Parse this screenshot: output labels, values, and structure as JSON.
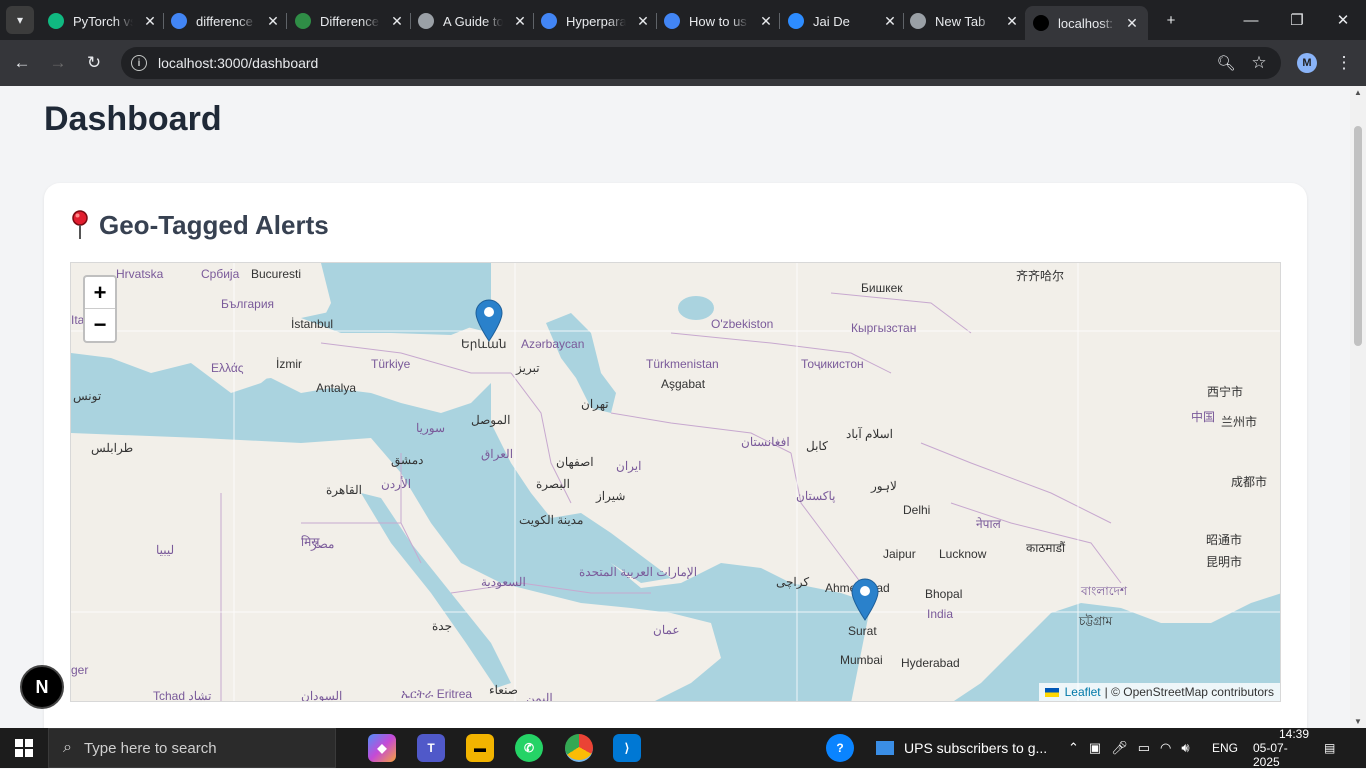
{
  "browser": {
    "tabs": [
      {
        "title": "PyTorch vs",
        "favicon": "pytorch-icon",
        "color": "#10b981"
      },
      {
        "title": "difference",
        "favicon": "google-icon",
        "color": "#4285f4"
      },
      {
        "title": "Difference",
        "favicon": "gfg-icon",
        "color": "#2f8d46"
      },
      {
        "title": "A Guide to",
        "favicon": "guide-icon",
        "color": "#9aa0a6"
      },
      {
        "title": "Hyperparam",
        "favicon": "google-icon",
        "color": "#4285f4"
      },
      {
        "title": "How to us",
        "favicon": "google-icon",
        "color": "#4285f4"
      },
      {
        "title": "Jai De",
        "favicon": "zoom-icon",
        "color": "#2d8cff"
      },
      {
        "title": "New Tab",
        "favicon": "chrome-icon",
        "color": "#9aa0a6"
      },
      {
        "title": "localhost:",
        "favicon": "vercel-icon",
        "color": "#000000"
      }
    ],
    "url": "localhost:3000/dashboard",
    "profile_initial": "M"
  },
  "page": {
    "title": "Dashboard",
    "card_title": "Geo-Tagged Alerts",
    "card_icon": "pin-icon"
  },
  "map": {
    "zoom_in": "+",
    "zoom_out": "−",
    "attribution_leaflet": "Leaflet",
    "attribution_osm": "| © OpenStreetMap contributors",
    "labels": [
      {
        "text": "Hrvatska",
        "type": "country"
      },
      {
        "text": "Србија",
        "type": "country"
      },
      {
        "text": "Bucuresti",
        "type": "city"
      },
      {
        "text": "България",
        "type": "country"
      },
      {
        "text": "İstanbul",
        "type": "city"
      },
      {
        "text": "Italia",
        "type": "country"
      },
      {
        "text": "İzmir",
        "type": "city"
      },
      {
        "text": "Türkiye",
        "type": "country"
      },
      {
        "text": "Ελλάς",
        "type": "country"
      },
      {
        "text": "Antalya",
        "type": "city"
      },
      {
        "text": "Երևան",
        "type": "city"
      },
      {
        "text": "Azərbaycan",
        "type": "country"
      },
      {
        "text": "O'zbekiston",
        "type": "country"
      },
      {
        "text": "Бишкек",
        "type": "city"
      },
      {
        "text": "Кыргызстан",
        "type": "country"
      },
      {
        "text": "Türkmenistan",
        "type": "country"
      },
      {
        "text": "Aşgabat",
        "type": "city"
      },
      {
        "text": "Тоҷикистон",
        "type": "country"
      },
      {
        "text": "تبریز",
        "type": "city"
      },
      {
        "text": "تهران",
        "type": "city"
      },
      {
        "text": "سوريا",
        "type": "country"
      },
      {
        "text": "الموصل",
        "type": "city"
      },
      {
        "text": "العراق",
        "type": "country"
      },
      {
        "text": "دمشق",
        "type": "city"
      },
      {
        "text": "الأردن",
        "type": "country"
      },
      {
        "text": "اصفهان",
        "type": "city"
      },
      {
        "text": "ایران",
        "type": "country"
      },
      {
        "text": "افغانستان",
        "type": "country"
      },
      {
        "text": "کابل",
        "type": "city"
      },
      {
        "text": "اسلام آباد",
        "type": "city"
      },
      {
        "text": "البصرة",
        "type": "city"
      },
      {
        "text": "شیراز",
        "type": "city"
      },
      {
        "text": "پاکستان",
        "type": "country"
      },
      {
        "text": "لاہور",
        "type": "city"
      },
      {
        "text": "القاهرة",
        "type": "city"
      },
      {
        "text": "مدينة الكويت",
        "type": "city"
      },
      {
        "text": "Delhi",
        "type": "city"
      },
      {
        "text": "मिस्र",
        "type": "country"
      },
      {
        "text": "مصر",
        "type": "country"
      },
      {
        "text": "Jaipur",
        "type": "city"
      },
      {
        "text": "Lucknow",
        "type": "city"
      },
      {
        "text": "नेपाल",
        "type": "country"
      },
      {
        "text": "काठमाडौं",
        "type": "city"
      },
      {
        "text": "ليبيا",
        "type": "country"
      },
      {
        "text": "الإمارات العربية المتحدة",
        "type": "country"
      },
      {
        "text": "كراچى",
        "type": "city"
      },
      {
        "text": "Ahmedabad",
        "type": "city"
      },
      {
        "text": "Bhopal",
        "type": "city"
      },
      {
        "text": "India",
        "type": "country"
      },
      {
        "text": "বাংলাদেশ",
        "type": "country"
      },
      {
        "text": "السعودية",
        "type": "country"
      },
      {
        "text": "Surat",
        "type": "city"
      },
      {
        "text": "جدة",
        "type": "city"
      },
      {
        "text": "عمان",
        "type": "country"
      },
      {
        "text": "Mumbai",
        "type": "city"
      },
      {
        "text": "Hyderabad",
        "type": "city"
      },
      {
        "text": "চট্টগ্রাম",
        "type": "city"
      },
      {
        "text": "طرابلس",
        "type": "city"
      },
      {
        "text": "تونس",
        "type": "city"
      },
      {
        "text": "齐齐哈尔",
        "type": "city"
      },
      {
        "text": "西宁市",
        "type": "city"
      },
      {
        "text": "中国",
        "type": "country"
      },
      {
        "text": "兰州市",
        "type": "city"
      },
      {
        "text": "成都市",
        "type": "city"
      },
      {
        "text": "昭通市",
        "type": "city"
      },
      {
        "text": "昆明市",
        "type": "city"
      },
      {
        "text": "Tchad تشاد",
        "type": "country"
      },
      {
        "text": "السودان",
        "type": "country"
      },
      {
        "text": "ኤርትራ Eritrea",
        "type": "country"
      },
      {
        "text": "صنعاء",
        "type": "city"
      },
      {
        "text": "اليمن",
        "type": "country"
      },
      {
        "text": "ger",
        "type": "country"
      }
    ],
    "markers": 2
  },
  "taskbar": {
    "search_placeholder": "Type here to search",
    "notification": "UPS subscribers to g...",
    "lang": "ENG",
    "time": "14:39",
    "date": "05-07-2025"
  }
}
